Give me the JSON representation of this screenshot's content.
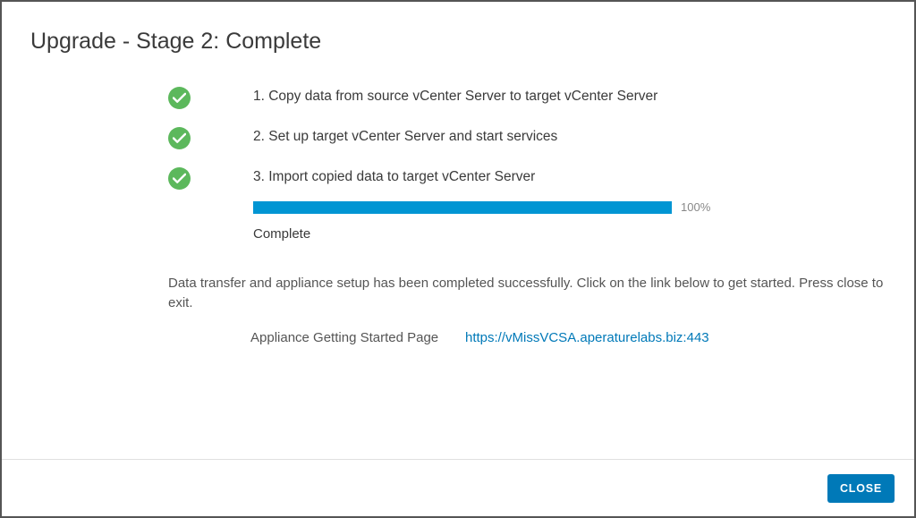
{
  "title": "Upgrade - Stage 2: Complete",
  "steps": {
    "s1": {
      "label": "1. Copy data from source vCenter Server to target vCenter Server"
    },
    "s2": {
      "label": "2. Set up target vCenter Server and start services"
    },
    "s3": {
      "label": "3. Import copied data to target vCenter Server",
      "progress_pct": "100%",
      "status": "Complete"
    }
  },
  "summary": {
    "text": "Data transfer and appliance setup has been completed successfully. Click on the link below to get started. Press close to exit.",
    "link_label": "Appliance Getting Started Page",
    "link_url": "https://vMissVCSA.aperaturelabs.biz:443"
  },
  "footer": {
    "close_label": "CLOSE"
  },
  "colors": {
    "accent": "#0079b8",
    "success": "#5cb85c",
    "progress": "#0095d3"
  }
}
